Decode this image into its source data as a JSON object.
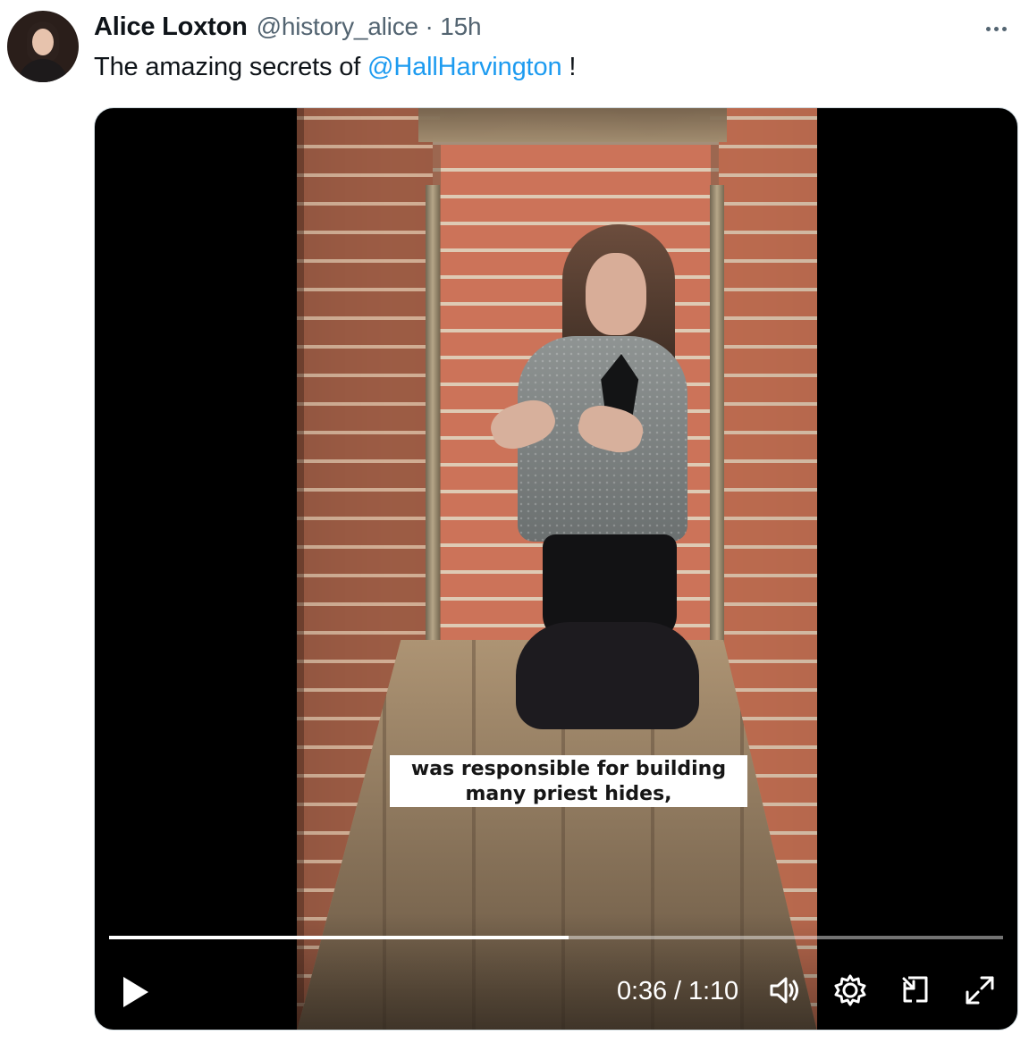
{
  "tweet": {
    "author": {
      "display_name": "Alice Loxton",
      "handle": "@history_alice",
      "separator": "·",
      "time": "15h"
    },
    "text": {
      "prefix": "The amazing secrets of ",
      "mention": "@HallHarvington",
      "suffix": " !"
    }
  },
  "video": {
    "caption": {
      "line1": "was responsible for building",
      "line2": "many priest hides,"
    },
    "progress": 0.514,
    "current_time": "0:36",
    "time_separator": "/",
    "duration": "1:10"
  },
  "icons": {
    "more": "more-dots-icon",
    "play": "play-icon",
    "volume": "volume-icon",
    "settings": "gear-icon",
    "miniplayer": "miniplayer-icon",
    "fullscreen": "expand-icon"
  },
  "colors": {
    "text": "#0f1419",
    "muted": "#536471",
    "link": "#1d9bf0",
    "video_bg": "#000000",
    "caption_bg": "#ffffff"
  }
}
